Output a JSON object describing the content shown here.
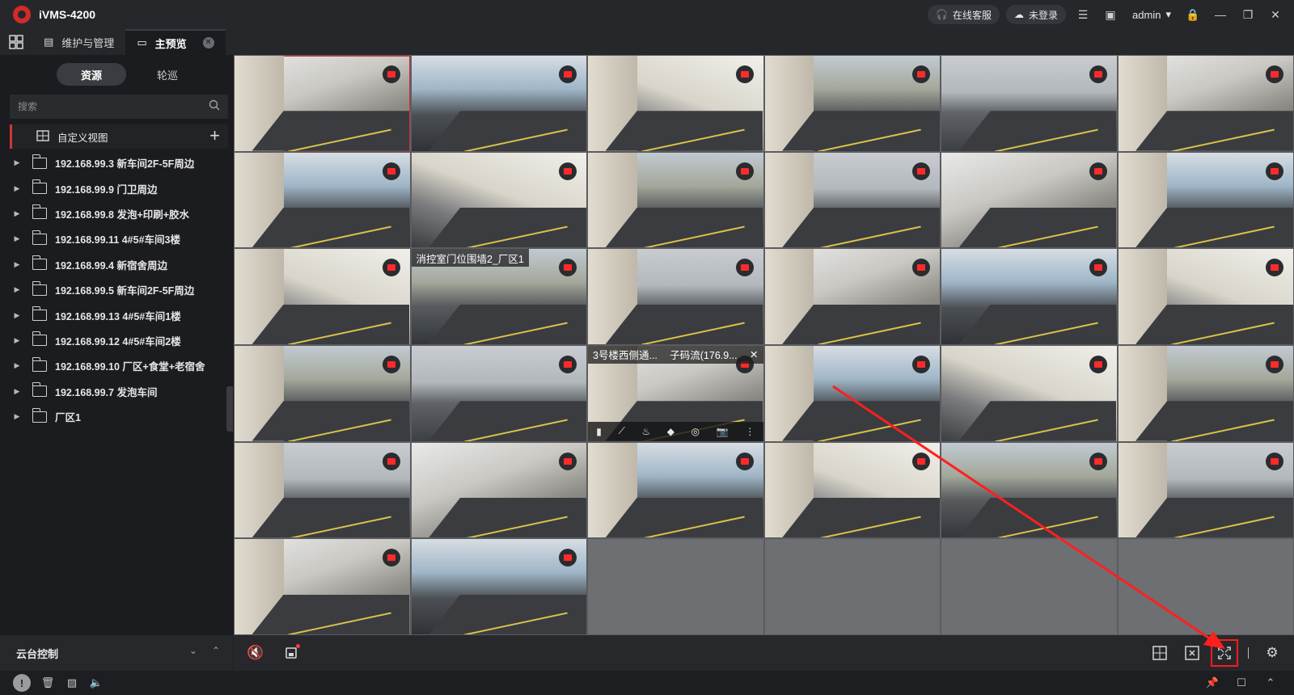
{
  "app": {
    "title": "iVMS-4200"
  },
  "topbar": {
    "online_service": "在线客服",
    "not_logged_in": "未登录",
    "username": "admin"
  },
  "tabs": [
    {
      "label": "维护与管理"
    },
    {
      "label": "主预览"
    }
  ],
  "left_panel": {
    "segment": [
      "资源",
      "轮巡"
    ],
    "search_placeholder": "搜索",
    "custom_view": "自定义视图",
    "tree": [
      "192.168.99.3 新车间2F-5F周边",
      "192.168.99.9 门卫周边",
      "192.168.99.8 发泡+印刷+胶水",
      "192.168.99.11 4#5#车间3楼",
      "192.168.99.4 新宿舍周边",
      "192.168.99.5 新车间2F-5F周边",
      "192.168.99.13 4#5#车间1楼",
      "192.168.99.12 4#5#车间2楼",
      "192.168.99.10 厂区+食堂+老宿舍",
      "192.168.99.7 发泡车间",
      "厂区1"
    ],
    "ptz_label": "云台控制"
  },
  "grid": {
    "label_cell_14": "消控室门位围墙2_厂区1",
    "label_cell_21_name": "3号楼西侧通...",
    "label_cell_21_stream": "子码流(176.9..."
  },
  "icons": {
    "rec": "record-icon",
    "mute": "speaker-mute-icon",
    "layout": "grid-layout-icon",
    "fullscreen": "fullscreen-icon",
    "settings": "gear-icon"
  },
  "colors": {
    "accent_red": "#d23434",
    "rec_red": "#ff2b2b",
    "background": "#1b1c1f"
  }
}
